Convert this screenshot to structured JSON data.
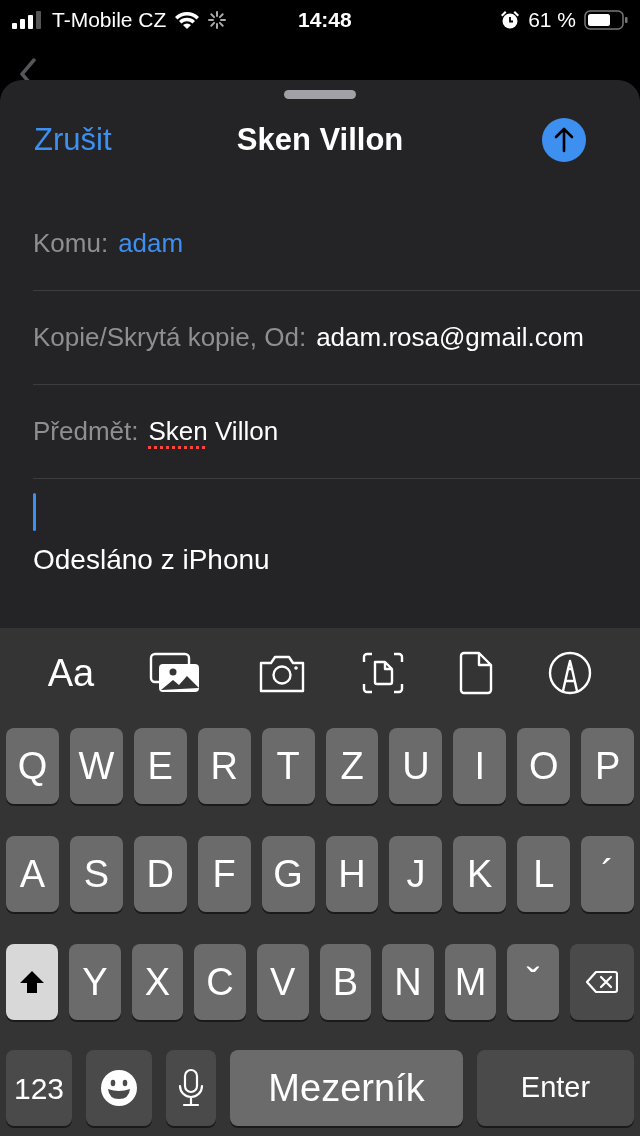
{
  "status_bar": {
    "carrier": "T-Mobile CZ",
    "time": "14:48",
    "battery": "61 %"
  },
  "compose": {
    "cancel": "Zrušit",
    "title": "Sken Villon",
    "fields": [
      {
        "kind": "recipient",
        "label": "Komu:",
        "value": [
          {
            "text": "adam",
            "misspelled": false
          }
        ]
      },
      {
        "kind": "plain",
        "label": "Kopie/Skrytá kopie, Od:",
        "value": [
          {
            "text": "adam.rosa@gmail.com",
            "misspelled": false
          }
        ]
      },
      {
        "kind": "plain",
        "label": "Předmět:",
        "value": [
          {
            "text": "Sken",
            "misspelled": true
          },
          {
            "text": " Villon",
            "misspelled": false
          }
        ]
      }
    ],
    "body": "Odesláno z iPhonu"
  },
  "toolbar": {
    "format_label": "Aa"
  },
  "keyboard": {
    "letter_rows": [
      [
        {
          "kind": "letter",
          "label": "Q"
        },
        {
          "kind": "letter",
          "label": "W"
        },
        {
          "kind": "letter",
          "label": "E"
        },
        {
          "kind": "letter",
          "label": "R"
        },
        {
          "kind": "letter",
          "label": "T"
        },
        {
          "kind": "letter",
          "label": "Z"
        },
        {
          "kind": "letter",
          "label": "U"
        },
        {
          "kind": "letter",
          "label": "I"
        },
        {
          "kind": "letter",
          "label": "O"
        },
        {
          "kind": "letter",
          "label": "P"
        }
      ],
      [
        {
          "kind": "letter",
          "label": "A"
        },
        {
          "kind": "letter",
          "label": "S"
        },
        {
          "kind": "letter",
          "label": "D"
        },
        {
          "kind": "letter",
          "label": "F"
        },
        {
          "kind": "letter",
          "label": "G"
        },
        {
          "kind": "letter",
          "label": "H"
        },
        {
          "kind": "letter",
          "label": "J"
        },
        {
          "kind": "letter",
          "label": "K"
        },
        {
          "kind": "letter",
          "label": "L"
        },
        {
          "kind": "letter",
          "label": "´"
        }
      ],
      [
        {
          "kind": "shift",
          "on": true
        },
        {
          "kind": "letter",
          "label": "Y"
        },
        {
          "kind": "letter",
          "label": "X"
        },
        {
          "kind": "letter",
          "label": "C"
        },
        {
          "kind": "letter",
          "label": "V"
        },
        {
          "kind": "letter",
          "label": "B"
        },
        {
          "kind": "letter",
          "label": "N"
        },
        {
          "kind": "letter",
          "label": "M"
        },
        {
          "kind": "letter",
          "label": "ˇ"
        },
        {
          "kind": "backspace"
        }
      ]
    ],
    "bottom_bar": {
      "numbers_key": "123",
      "space_key": "Mezerník",
      "return_key": "Enter"
    }
  }
}
